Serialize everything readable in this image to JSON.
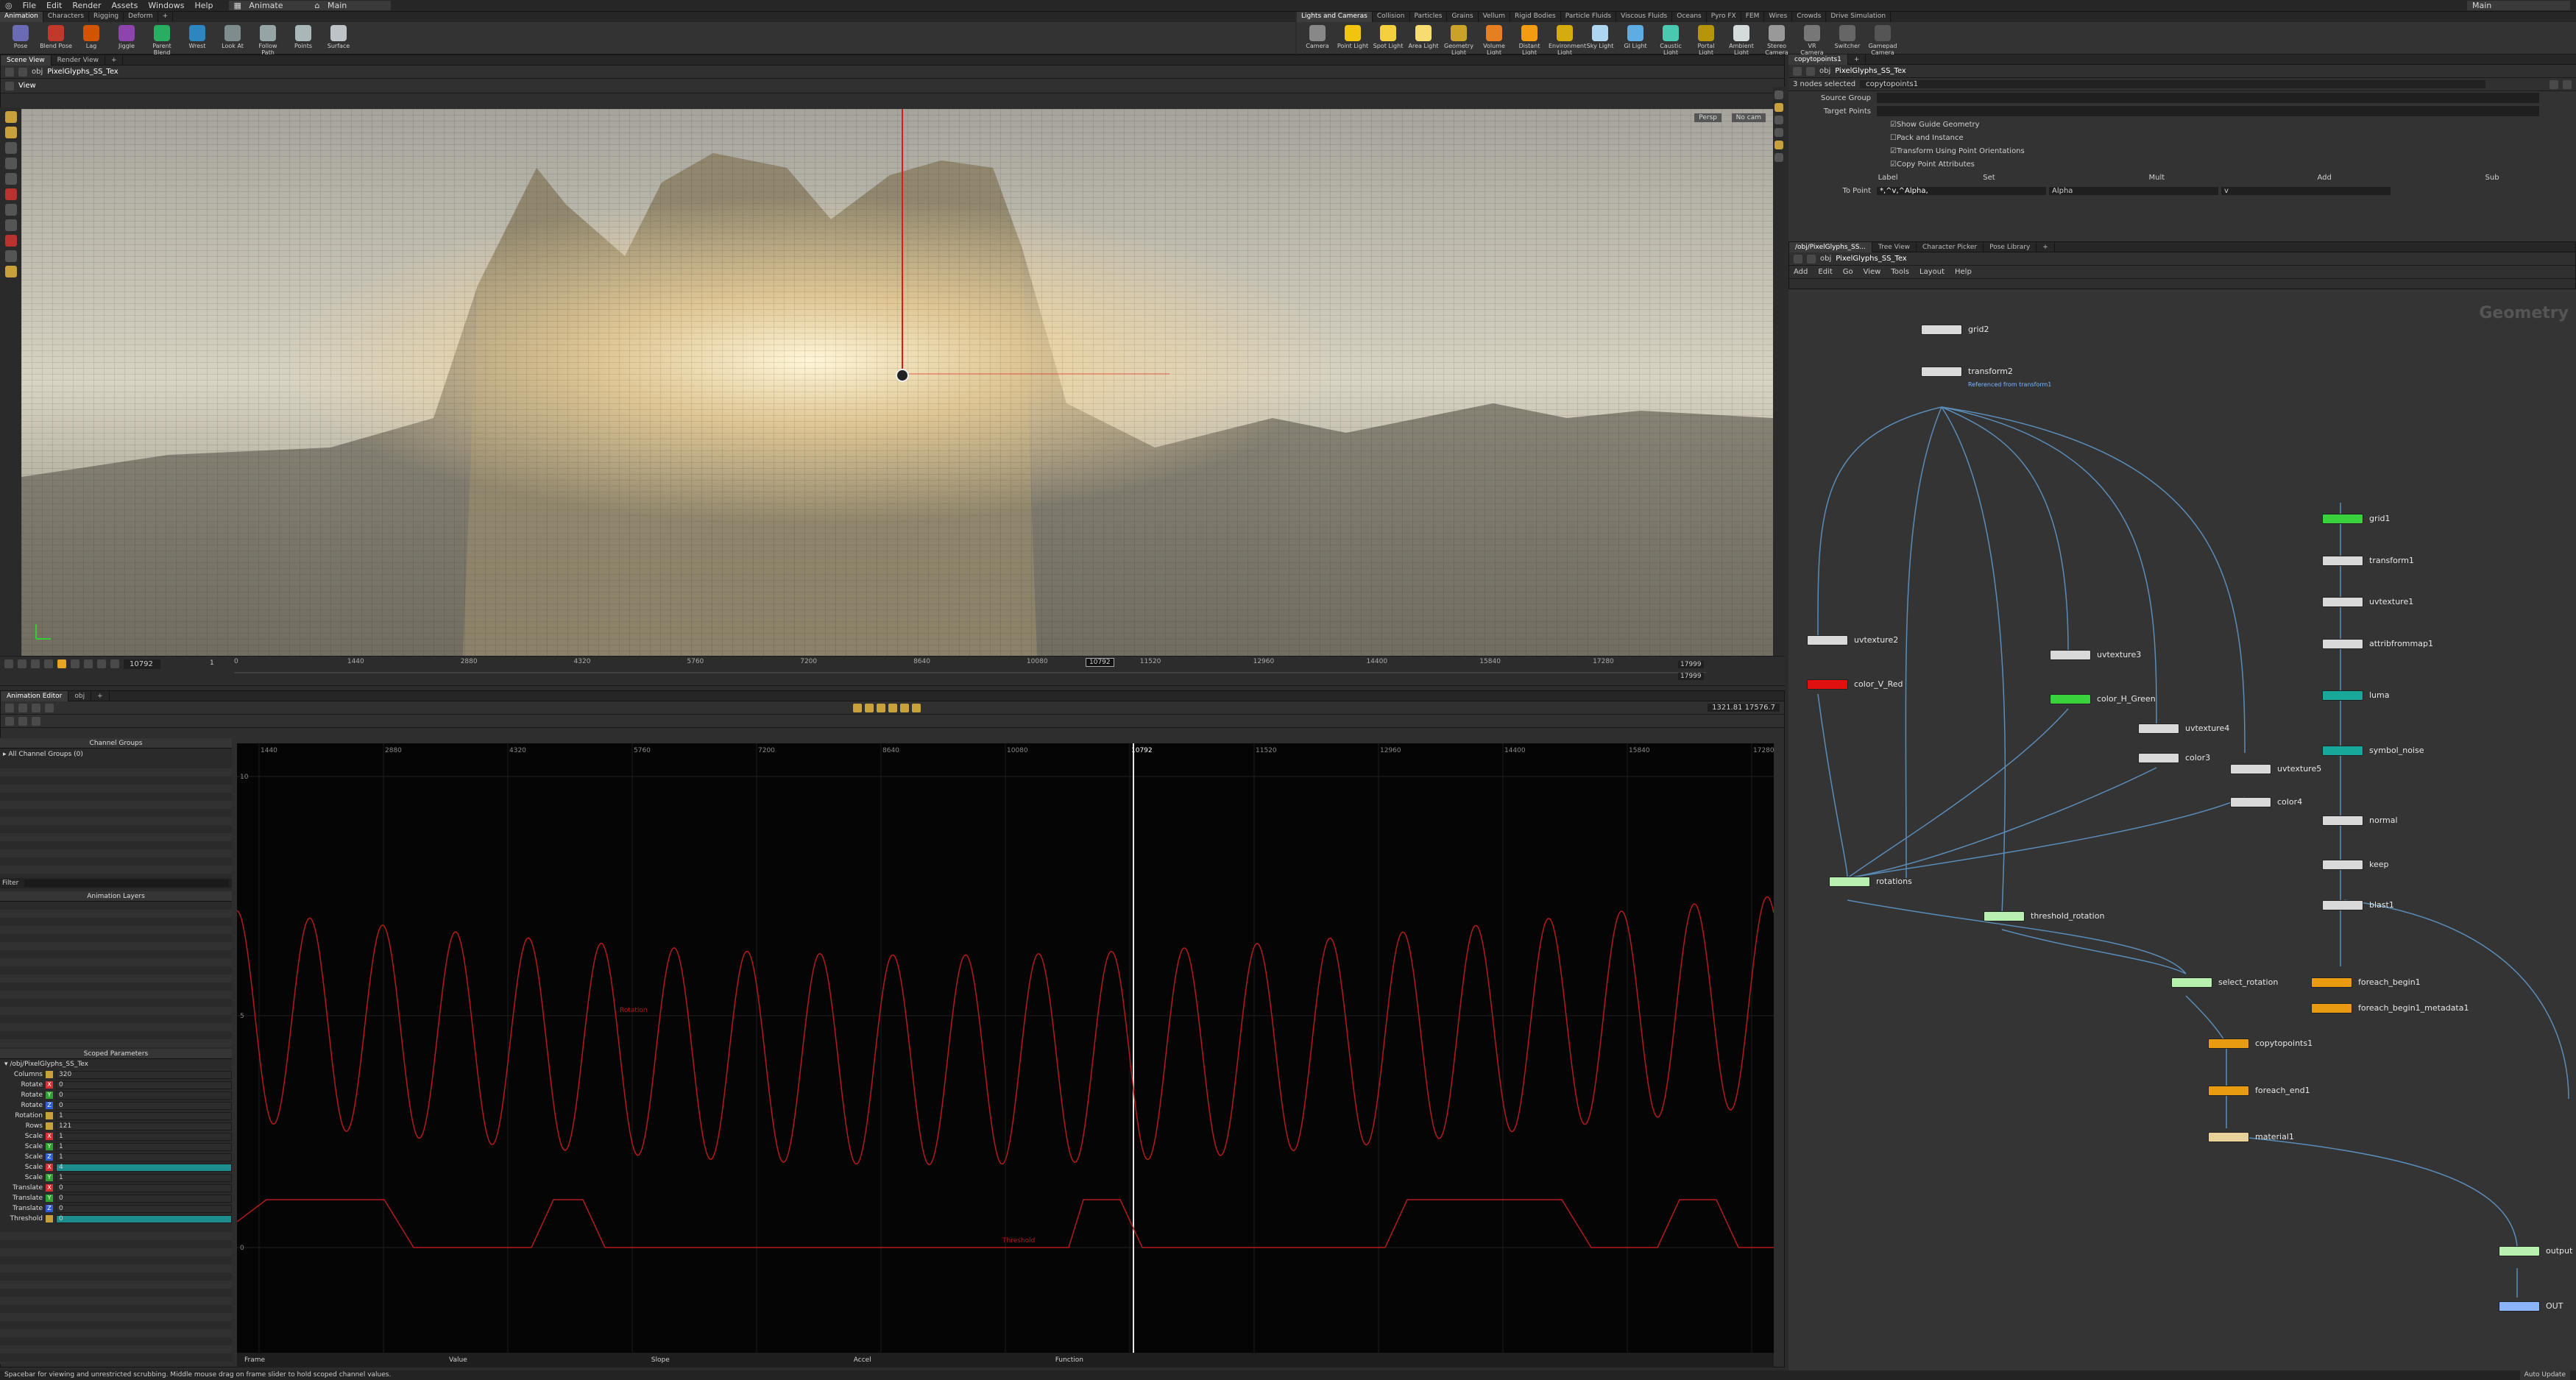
{
  "menu": [
    "File",
    "Edit",
    "Render",
    "Assets",
    "Windows",
    "Help"
  ],
  "desktop": {
    "left": "Animate",
    "right": "Main"
  },
  "shelf_left": {
    "tabs": [
      "Animation",
      "Characters",
      "Rigging",
      "Deform"
    ],
    "tools": [
      "Pose",
      "Blend Pose",
      "Lag",
      "Jiggle",
      "Parent Blend",
      "Wrest",
      "Look At",
      "Follow Path",
      "Points",
      "Surface"
    ]
  },
  "shelf_right": {
    "tabs": [
      "Lights and Cameras",
      "Collision",
      "Particles",
      "Grains",
      "Vellum",
      "Rigid Bodies",
      "Particle Fluids",
      "Viscous Fluids",
      "Oceans",
      "Pyro FX",
      "FEM",
      "Wires",
      "Crowds",
      "Drive Simulation"
    ],
    "tools": [
      "Camera",
      "Point Light",
      "Spot Light",
      "Area Light",
      "Geometry Light",
      "Volume Light",
      "Distant Light",
      "Environment Light",
      "Sky Light",
      "GI Light",
      "Caustic Light",
      "Portal Light",
      "Ambient Light",
      "Stereo Camera",
      "VR Camera",
      "Switcher",
      "Gamepad Camera"
    ]
  },
  "viewer": {
    "tabs": [
      "Scene View",
      "Render View"
    ],
    "path": "obj",
    "node": "PixelGlyphs_SS_Tex",
    "label": "View",
    "camera_mode": "Persp",
    "cam": "No cam"
  },
  "timeline": {
    "start": "1",
    "frame": "10792",
    "ticks": [
      "0",
      "1440",
      "2880",
      "4320",
      "5760",
      "7200",
      "8640",
      "10080",
      "11520",
      "12960",
      "14400",
      "15840",
      "17280"
    ],
    "current": "10792",
    "end_a": "17999",
    "end_b": "17999"
  },
  "anim": {
    "tabs": [
      "Animation Editor",
      "obj"
    ],
    "channel_groups": "Channel Groups",
    "all_groups": "All Channel Groups (0)",
    "filter": "Filter",
    "anim_layers": "Animation Layers",
    "scoped": "Scoped Parameters",
    "tree": "/obj/PixelGlyphs_SS_Tex",
    "coords": "1321.81   17576.7",
    "params": [
      {
        "name": "Columns",
        "axis": "",
        "v": "320"
      },
      {
        "name": "Rotate",
        "axis": "X",
        "v": "0"
      },
      {
        "name": "Rotate",
        "axis": "Y",
        "v": "0"
      },
      {
        "name": "Rotate",
        "axis": "Z",
        "v": "0"
      },
      {
        "name": "Rotation",
        "axis": "",
        "v": "1"
      },
      {
        "name": "Rows",
        "axis": "",
        "v": "121"
      },
      {
        "name": "Scale",
        "axis": "X",
        "v": "1"
      },
      {
        "name": "Scale",
        "axis": "Y",
        "v": "1"
      },
      {
        "name": "Scale",
        "axis": "Z",
        "v": "1"
      },
      {
        "name": "Scale",
        "axis": "X",
        "v": "4"
      },
      {
        "name": "Scale",
        "axis": "Y",
        "v": "1"
      },
      {
        "name": "Translate",
        "axis": "X",
        "v": "0"
      },
      {
        "name": "Translate",
        "axis": "Y",
        "v": "0"
      },
      {
        "name": "Translate",
        "axis": "Z",
        "v": "0"
      },
      {
        "name": "Threshold",
        "axis": "",
        "v": "0"
      }
    ],
    "graph_ticks": [
      "1440",
      "2880",
      "4320",
      "5760",
      "7200",
      "8640",
      "10080",
      "10792",
      "11520",
      "12960",
      "14400",
      "15840",
      "17280"
    ],
    "y_ticks": [
      "10",
      "5",
      "0"
    ],
    "graph_labels": [
      "Rotation",
      "Threshold"
    ],
    "footer": [
      "Frame",
      "Value",
      "Slope",
      "Accel",
      "Function"
    ]
  },
  "params_pane": {
    "tab": "copytopoints1",
    "path": "obj",
    "node": "PixelGlyphs_SS_Tex",
    "selected": "3 nodes selected",
    "node_name": "copytopoints1",
    "source_group": "Source Group",
    "target_points": "Target Points",
    "checks": [
      "Show Guide Geometry",
      "Pack and Instance",
      "Transform Using Point Orientations",
      "Copy Point Attributes"
    ],
    "attr_header": [
      "Label",
      "Set",
      "Mult",
      "Add",
      "Sub"
    ],
    "to_point_label": "To Point",
    "to_point_value": "*,^v,^Alpha,",
    "alpha": "Alpha",
    "v": "v"
  },
  "network": {
    "tabs": [
      "/obj/PixelGlyphs_SS...",
      "Tree View",
      "Character Picker",
      "Pose Library"
    ],
    "path": "obj",
    "node": "PixelGlyphs_SS_Tex",
    "menu": [
      "Add",
      "Edit",
      "Go",
      "View",
      "Tools",
      "Layout",
      "Help"
    ],
    "context": "Geometry",
    "nodes": {
      "grid2": "grid2",
      "transform2": "transform2",
      "transform2_sub": "Referenced from transform1",
      "uvtexture2": "uvtexture2",
      "color_V_Red": "color_V_Red",
      "uvtexture3": "uvtexture3",
      "color_H_Green": "color_H_Green",
      "uvtexture4": "uvtexture4",
      "color3": "color3",
      "uvtexture5": "uvtexture5",
      "color4": "color4",
      "rotations": "rotations",
      "threshold_rotation": "threshold_rotation",
      "select_rotation": "select_rotation",
      "grid1": "grid1",
      "transform1": "transform1",
      "uvtexture1": "uvtexture1",
      "attribfrommap1": "attribfrommap1",
      "luma": "luma",
      "symbol_noise": "symbol_noise",
      "normal": "normal",
      "keep": "keep",
      "blast1": "blast1",
      "foreach_begin1": "foreach_begin1",
      "foreach_begin1_metadata1": "foreach_begin1_metadata1",
      "copytopoints1": "copytopoints1",
      "foreach_end1": "foreach_end1",
      "material1": "material1",
      "output": "output",
      "OUT": "OUT"
    }
  },
  "status": "Spacebar for viewing and unrestricted scrubbing. Middle mouse drag on frame slider to hold scoped channel values.",
  "auto_update": "Auto Update",
  "colors": {
    "accent": "#e8a522",
    "red_curve": "#b31b1b",
    "node_green": "#39d13c",
    "node_red": "#e01010",
    "node_orange": "#e89a10",
    "node_teal": "#18a89a"
  }
}
